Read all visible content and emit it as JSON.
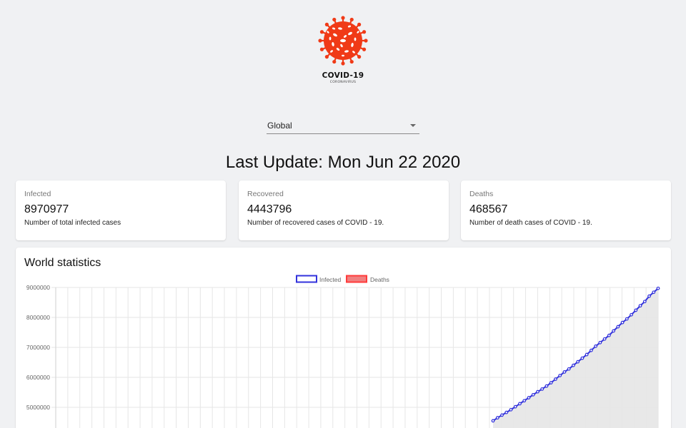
{
  "logo": {
    "title": "COVID-19",
    "subtitle": "CORONAVIRUS",
    "color": "#f03a17"
  },
  "region_select": {
    "value": "Global"
  },
  "last_update": "Last Update: Mon Jun 22 2020",
  "cards": [
    {
      "label": "Infected",
      "value": "8970977",
      "description": "Number of total infected cases"
    },
    {
      "label": "Recovered",
      "value": "4443796",
      "description": "Number of recovered cases of COVID - 19."
    },
    {
      "label": "Deaths",
      "value": "468567",
      "description": "Number of death cases of COVID - 19."
    }
  ],
  "chart_title": "World statistics",
  "chart_data": {
    "type": "line",
    "title": "World statistics",
    "legend": {
      "placement": "top-center"
    },
    "grid": true,
    "y_ticks": [
      "9000000",
      "8000000",
      "7000000",
      "6000000",
      "5000000"
    ],
    "ylim_visible": [
      4300000,
      9000000
    ],
    "series": [
      {
        "name": "Infected",
        "color": "#3232dc",
        "fill": "#e5e5e5",
        "note_points": "daily cumulative infections; leading points below visible range",
        "values": [
          4550000,
          4650000,
          4740000,
          4830000,
          4920000,
          5020000,
          5120000,
          5220000,
          5320000,
          5420000,
          5520000,
          5610000,
          5710000,
          5820000,
          5940000,
          6060000,
          6180000,
          6280000,
          6400000,
          6520000,
          6640000,
          6760000,
          6900000,
          7040000,
          7160000,
          7280000,
          7400000,
          7550000,
          7690000,
          7830000,
          7950000,
          8090000,
          8240000,
          8390000,
          8530000,
          8710000,
          8840000,
          8970977
        ]
      },
      {
        "name": "Deaths",
        "color": "#ff3b3b",
        "fill": "#f08080",
        "values": []
      }
    ]
  }
}
